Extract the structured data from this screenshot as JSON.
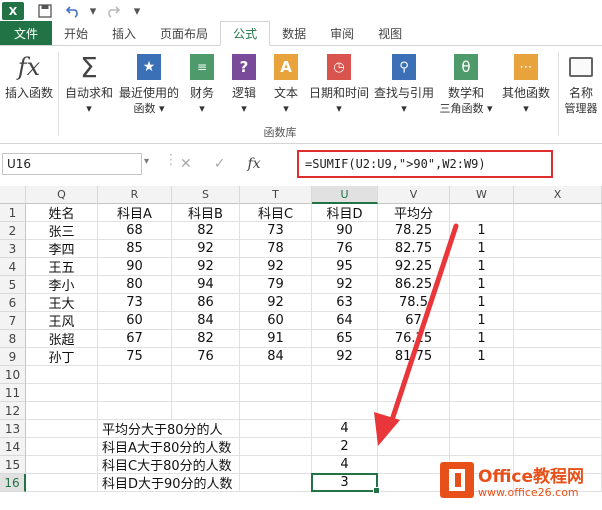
{
  "toolbar": {
    "app_icon": "excel-icon",
    "save": "save-icon",
    "undo": "undo-icon",
    "redo": "redo-icon"
  },
  "tabs": [
    "开始",
    "插入",
    "页面布局",
    "公式",
    "数据",
    "审阅",
    "视图"
  ],
  "file_tab": "文件",
  "active_tab": "公式",
  "ribbon": {
    "buttons": [
      {
        "label": "插入函数",
        "sub": ""
      },
      {
        "label": "自动求和",
        "sub": "▾"
      },
      {
        "label": "最近使用的",
        "sub": "函数 ▾"
      },
      {
        "label": "财务",
        "sub": "▾"
      },
      {
        "label": "逻辑",
        "sub": "▾"
      },
      {
        "label": "文本",
        "sub": "▾"
      },
      {
        "label": "日期和时间",
        "sub": "▾"
      },
      {
        "label": "查找与引用",
        "sub": "▾"
      },
      {
        "label": "数学和",
        "sub": "三角函数 ▾"
      },
      {
        "label": "其他函数",
        "sub": "▾"
      },
      {
        "label": "名称",
        "sub": "管理器"
      }
    ],
    "group_label": "函数库"
  },
  "formula_bar": {
    "name_box": "U16",
    "formula": "=SUMIF(U2:U9,\">90\",W2:W9)"
  },
  "columns": [
    "Q",
    "R",
    "S",
    "T",
    "U",
    "V",
    "W",
    "X"
  ],
  "rows": [
    [
      "姓名",
      "科目A",
      "科目B",
      "科目C",
      "科目D",
      "平均分",
      "",
      ""
    ],
    [
      "张三",
      "68",
      "82",
      "73",
      "90",
      "78.25",
      "1",
      ""
    ],
    [
      "李四",
      "85",
      "92",
      "78",
      "76",
      "82.75",
      "1",
      ""
    ],
    [
      "王五",
      "90",
      "92",
      "92",
      "95",
      "92.25",
      "1",
      ""
    ],
    [
      "李小",
      "80",
      "94",
      "79",
      "92",
      "86.25",
      "1",
      ""
    ],
    [
      "王大",
      "73",
      "86",
      "92",
      "63",
      "78.5",
      "1",
      ""
    ],
    [
      "王风",
      "60",
      "84",
      "60",
      "64",
      "67",
      "1",
      ""
    ],
    [
      "张超",
      "67",
      "82",
      "91",
      "65",
      "76.25",
      "1",
      ""
    ],
    [
      "孙丁",
      "75",
      "76",
      "84",
      "92",
      "81.75",
      "1",
      ""
    ],
    [
      "",
      "",
      "",
      "",
      "",
      "",
      "",
      ""
    ],
    [
      "",
      "",
      "",
      "",
      "",
      "",
      "",
      ""
    ],
    [
      "",
      "",
      "",
      "",
      "",
      "",
      "",
      ""
    ],
    [
      "",
      "平均分大于80分的人",
      "",
      "",
      "4",
      "",
      "",
      ""
    ],
    [
      "",
      "科目A大于80分的人数",
      "",
      "",
      "2",
      "",
      "",
      ""
    ],
    [
      "",
      "科目C大于80分的人数",
      "",
      "",
      "4",
      "",
      "",
      ""
    ],
    [
      "",
      "科目D大于90分的人数",
      "",
      "",
      "3",
      "",
      "",
      ""
    ]
  ],
  "row_numbers": [
    "1",
    "2",
    "3",
    "4",
    "5",
    "6",
    "7",
    "8",
    "9",
    "10",
    "11",
    "12",
    "13",
    "14",
    "15",
    "16"
  ],
  "selected_cell": "U16",
  "watermark": {
    "brand": "Office教程网",
    "url": "www.office26.com"
  },
  "colors": {
    "accent": "#217346",
    "highlight": "#e02d2d"
  }
}
